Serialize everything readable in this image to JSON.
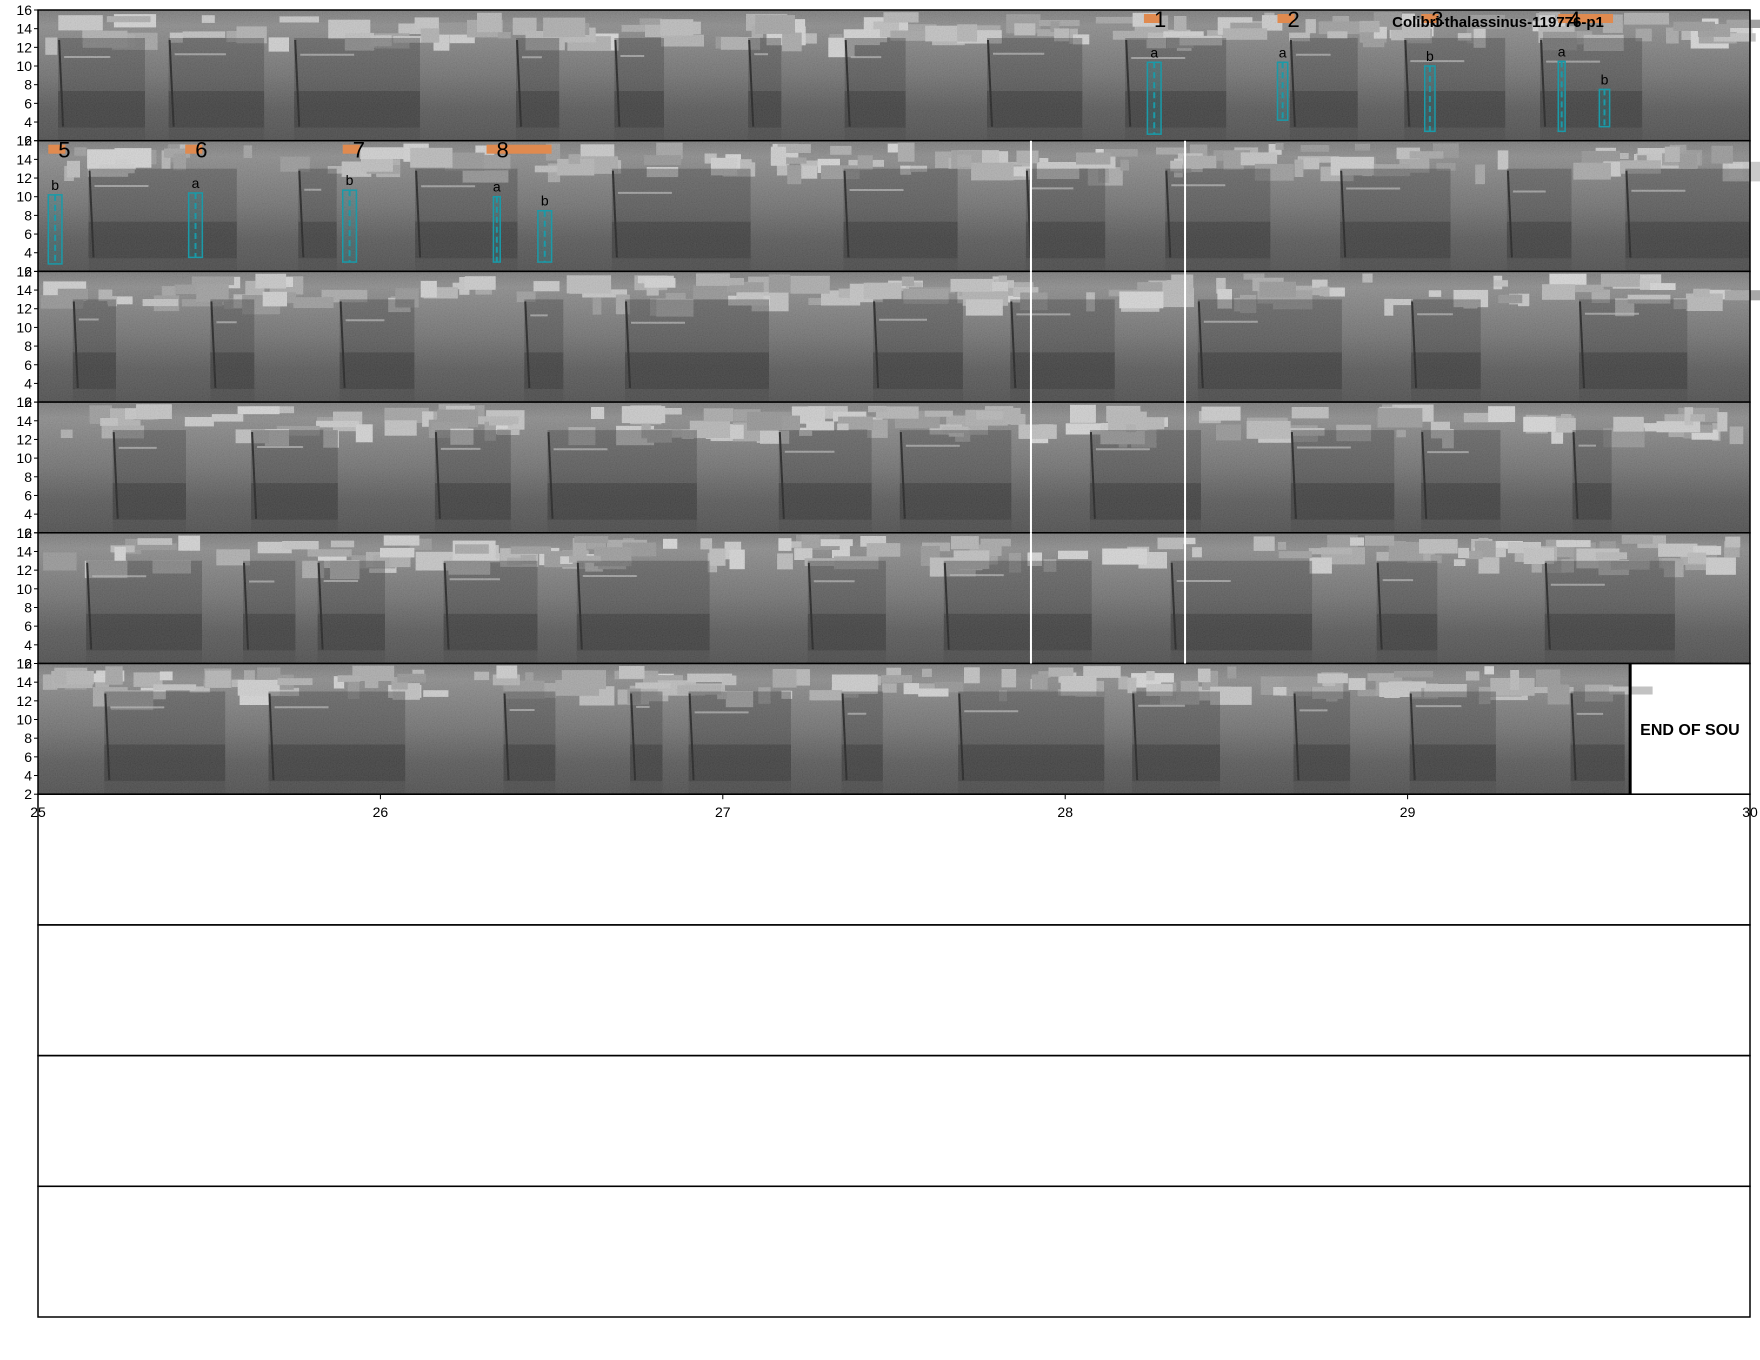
{
  "chart_data": {
    "type": "spectrogram",
    "title": "Colibri-thalassinus-119776-p1",
    "ylim": [
      2,
      16
    ],
    "yticks": [
      2,
      4,
      6,
      8,
      10,
      12,
      14,
      16
    ],
    "xlim": [
      25,
      30
    ],
    "xticks": [
      25,
      26,
      27,
      28,
      29,
      30
    ],
    "rows_total": 10,
    "rows_with_spectrogram": 6,
    "end_label": "END OF SOU",
    "end_x": 29.65,
    "white_markers": [
      {
        "row": 1,
        "x": 27.9
      },
      {
        "row": 1,
        "x": 28.35
      },
      {
        "row": 2,
        "x": 27.9
      },
      {
        "row": 2,
        "x": 28.35
      },
      {
        "row": 3,
        "x": 27.9
      },
      {
        "row": 3,
        "x": 28.35
      },
      {
        "row": 4,
        "x": 27.9
      },
      {
        "row": 4,
        "x": 28.35
      }
    ],
    "annotations": [
      {
        "num": "1",
        "row": 0,
        "bar": [
          28.23,
          28.28
        ],
        "boxes": [
          {
            "letter": "a",
            "x0": 28.24,
            "x1": 28.28,
            "ylo": 2.7,
            "yhi": 10.4
          }
        ]
      },
      {
        "num": "2",
        "row": 0,
        "bar": [
          28.62,
          28.67
        ],
        "boxes": [
          {
            "letter": "a",
            "x0": 28.62,
            "x1": 28.65,
            "ylo": 4.2,
            "yhi": 10.4
          }
        ]
      },
      {
        "num": "3",
        "row": 0,
        "bar": [
          29.04,
          29.09
        ],
        "boxes": [
          {
            "letter": "b",
            "x0": 29.05,
            "x1": 29.08,
            "ylo": 3.0,
            "yhi": 10.0
          }
        ]
      },
      {
        "num": "4",
        "row": 0,
        "bar": [
          29.44,
          29.6
        ],
        "boxes": [
          {
            "letter": "a",
            "x0": 29.44,
            "x1": 29.46,
            "ylo": 3.0,
            "yhi": 10.5
          },
          {
            "letter": "b",
            "x0": 29.56,
            "x1": 29.59,
            "ylo": 3.5,
            "yhi": 7.5
          }
        ]
      },
      {
        "num": "5",
        "row": 1,
        "bar": [
          25.03,
          25.08
        ],
        "boxes": [
          {
            "letter": "b",
            "x0": 25.03,
            "x1": 25.07,
            "ylo": 2.8,
            "yhi": 10.2
          }
        ]
      },
      {
        "num": "6",
        "row": 1,
        "bar": [
          25.43,
          25.48
        ],
        "boxes": [
          {
            "letter": "a",
            "x0": 25.44,
            "x1": 25.48,
            "ylo": 3.5,
            "yhi": 10.4
          }
        ]
      },
      {
        "num": "7",
        "row": 1,
        "bar": [
          25.89,
          25.94
        ],
        "boxes": [
          {
            "letter": "b",
            "x0": 25.89,
            "x1": 25.93,
            "ylo": 3.0,
            "yhi": 10.7
          }
        ]
      },
      {
        "num": "8",
        "row": 1,
        "bar": [
          26.31,
          26.5
        ],
        "boxes": [
          {
            "letter": "a",
            "x0": 26.33,
            "x1": 26.35,
            "ylo": 3.0,
            "yhi": 10.0
          },
          {
            "letter": "b",
            "x0": 26.46,
            "x1": 26.5,
            "ylo": 3.0,
            "yhi": 8.5
          }
        ]
      }
    ],
    "colors": {
      "bar": "#e08a4f",
      "box": "#1a9aa8",
      "marker": "#ffffff"
    }
  }
}
